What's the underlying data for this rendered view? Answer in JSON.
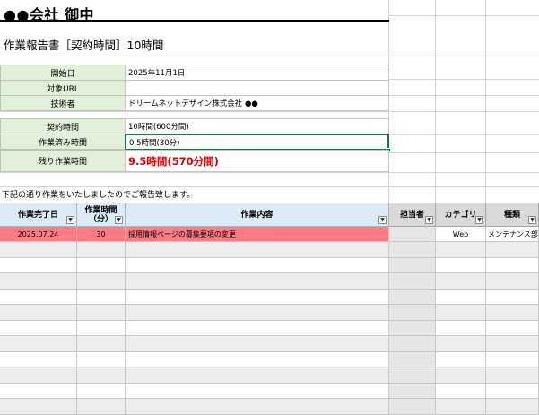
{
  "header": {
    "title": "●●会社 御中",
    "subtitle": "作業報告書［契約時間］10時間"
  },
  "info": {
    "start_label": "開始日",
    "start_value": "2025年11月1日",
    "url_label": "対象URL",
    "url_value": "",
    "engineer_label": "技術者",
    "engineer_value": "ドリームネットデザイン株式会社 ●●"
  },
  "hours": {
    "contract_label": "契約時間",
    "contract_value": "10時間(600分間)",
    "done_label": "作業済み時間",
    "done_value": "0.5時間(30分)",
    "remaining_label": "残り作業時間",
    "remaining_value": "9.5時間(570分間)"
  },
  "note": "下記の通り作業をいたしましたのでご報告致します。",
  "table": {
    "headers": {
      "date": "作業完了日",
      "minutes_line1": "作業時間",
      "minutes_line2": "（分）",
      "content": "作業内容",
      "person": "担当者",
      "category": "カテゴリ",
      "kind": "種類"
    },
    "rows": [
      {
        "date": "2025.07.24",
        "minutes": "30",
        "content": "採用情報ページの募集要項の変更",
        "person": "",
        "category": "Web",
        "kind": "メンテナンス部"
      }
    ]
  },
  "colors": {
    "label_fill": "#e2efda",
    "header_blue": "#ddebf7",
    "header_gray": "#d9d9d9",
    "row_highlight": "#ff7c80",
    "remaining_text": "#e00000",
    "selection": "#217346"
  },
  "icons": {
    "filter_dropdown": "filter-dropdown-icon"
  }
}
